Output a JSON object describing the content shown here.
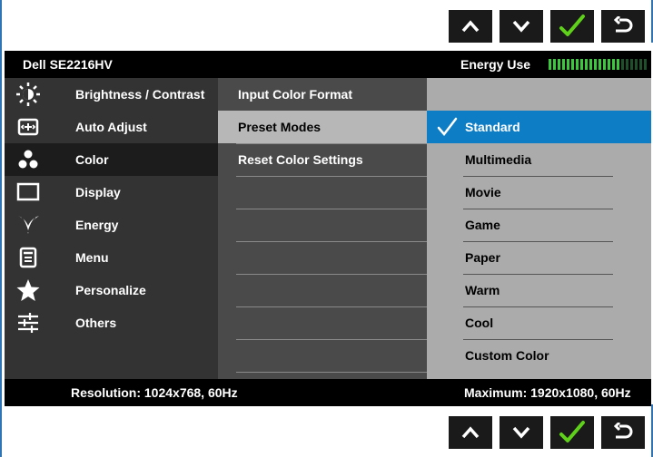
{
  "nav": {
    "buttons": [
      {
        "name": "up-arrow-icon"
      },
      {
        "name": "down-arrow-icon"
      },
      {
        "name": "checkmark-icon"
      },
      {
        "name": "back-return-icon"
      }
    ],
    "accent_check": "#5fd11b"
  },
  "header": {
    "model": "Dell SE2216HV",
    "energy_label": "Energy Use",
    "energy_level": 0.72,
    "energy_color": "#3cc83c"
  },
  "menu": {
    "items": [
      {
        "label": "Brightness / Contrast",
        "icon": "brightness-sun-icon"
      },
      {
        "label": "Auto Adjust",
        "icon": "auto-adjust-icon"
      },
      {
        "label": "Color",
        "icon": "color-dots-icon",
        "active": true
      },
      {
        "label": "Display",
        "icon": "display-rectangle-icon"
      },
      {
        "label": "Energy",
        "icon": "energy-leaf-icon"
      },
      {
        "label": "Menu",
        "icon": "menu-list-icon"
      },
      {
        "label": "Personalize",
        "icon": "star-icon"
      },
      {
        "label": "Others",
        "icon": "sliders-icon"
      }
    ]
  },
  "submenu": {
    "items": [
      {
        "label": "Input Color Format"
      },
      {
        "label": "Preset Modes",
        "selected": true
      },
      {
        "label": "Reset Color Settings"
      }
    ]
  },
  "options": {
    "items": [
      {
        "label": "Standard",
        "selected": true
      },
      {
        "label": "Multimedia"
      },
      {
        "label": "Movie"
      },
      {
        "label": "Game"
      },
      {
        "label": "Paper"
      },
      {
        "label": "Warm"
      },
      {
        "label": "Cool"
      },
      {
        "label": "Custom Color"
      }
    ],
    "selected_color": "#0d7dc6"
  },
  "status": {
    "resolution": "Resolution: 1024x768, 60Hz",
    "maximum": "Maximum: 1920x1080, 60Hz"
  }
}
